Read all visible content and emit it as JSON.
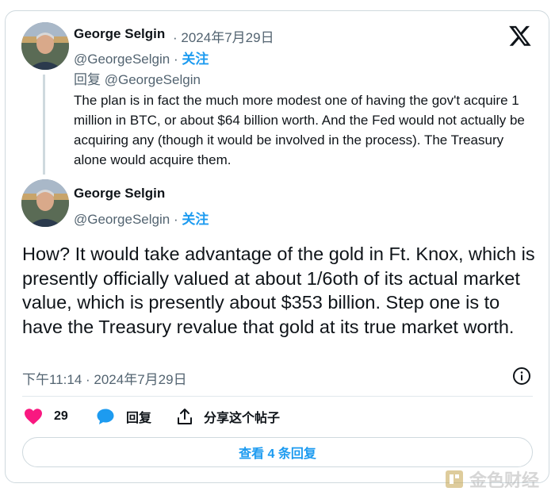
{
  "colors": {
    "accent": "#1d9bf0",
    "like": "#f91880",
    "muted": "#536471",
    "text": "#0f1419",
    "border": "#cfd9de"
  },
  "first_tweet": {
    "author_name": "George Selgin",
    "date": " · 2024年7月29日",
    "handle": "@GeorgeSelgin",
    "separator": " · ",
    "follow": "关注",
    "reply_to": "回复 @GeorgeSelgin",
    "text": "The plan is in fact the much more modest one of having the gov't acquire 1 million in BTC, or about $64 billion worth. And the Fed would not actually be acquiring any (though it would be involved in the process). The Treasury alone would acquire them."
  },
  "main_tweet": {
    "author_name": "George Selgin",
    "handle": "@GeorgeSelgin",
    "separator": " · ",
    "follow": "关注",
    "text": "How? It would take advantage of the gold in Ft. Knox, which is presently officially valued at about 1/6oth of its actual market value, which is presently about $353 billion. Step one is to have the Treasury revalue that gold at its true market worth.",
    "timestamp": "下午11:14 · 2024年7月29日"
  },
  "actions": {
    "like_count": "29",
    "reply_label": "回复",
    "share_label": "分享这个帖子"
  },
  "view_replies_label": "查看 4 条回复",
  "icons": [
    "x-logo-icon",
    "info-icon",
    "heart-icon",
    "reply-bubble-icon",
    "share-icon"
  ],
  "watermark": "金色财经"
}
